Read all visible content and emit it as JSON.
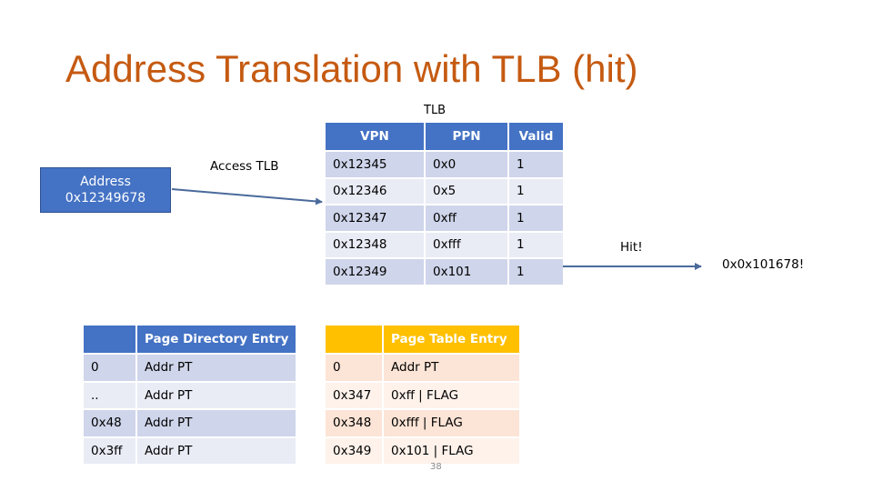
{
  "slide": {
    "title": "Address Translation with TLB (hit)",
    "page_number": "38"
  },
  "address_box": {
    "line1": "Address",
    "line2": "0x12349678"
  },
  "labels": {
    "access_tlb": "Access TLB",
    "tlb_title": "TLB",
    "hit": "Hit!",
    "result": "0x0x101678!"
  },
  "colors": {
    "title": "#C55A11",
    "blue_header": "#4472C4",
    "blue_row_dark": "#CFD5EA",
    "blue_row_light": "#E9EBF5",
    "gold_header": "#FFC000",
    "peach_row_dark": "#FCE4D6",
    "peach_row_light": "#FEF2EB",
    "arrow": "#4A6A9B"
  },
  "tlb": {
    "headers": [
      "VPN",
      "PPN",
      "Valid"
    ],
    "rows": [
      [
        "0x12345",
        "0x0",
        "1"
      ],
      [
        "0x12346",
        "0x5",
        "1"
      ],
      [
        "0x12347",
        "0xff",
        "1"
      ],
      [
        "0x12348",
        "0xfff",
        "1"
      ],
      [
        "0x12349",
        "0x101",
        "1"
      ]
    ]
  },
  "page_directory": {
    "headers": [
      "",
      "Page Directory Entry"
    ],
    "rows": [
      [
        "0",
        "Addr PT"
      ],
      [
        "..",
        "Addr PT"
      ],
      [
        "0x48",
        "Addr PT"
      ],
      [
        "0x3ff",
        "Addr PT"
      ]
    ]
  },
  "page_table": {
    "headers": [
      "",
      "Page Table Entry"
    ],
    "rows": [
      [
        "0",
        "Addr PT"
      ],
      [
        "0x347",
        "0xff | FLAG"
      ],
      [
        "0x348",
        "0xfff | FLAG"
      ],
      [
        "0x349",
        "0x101 | FLAG"
      ]
    ]
  }
}
